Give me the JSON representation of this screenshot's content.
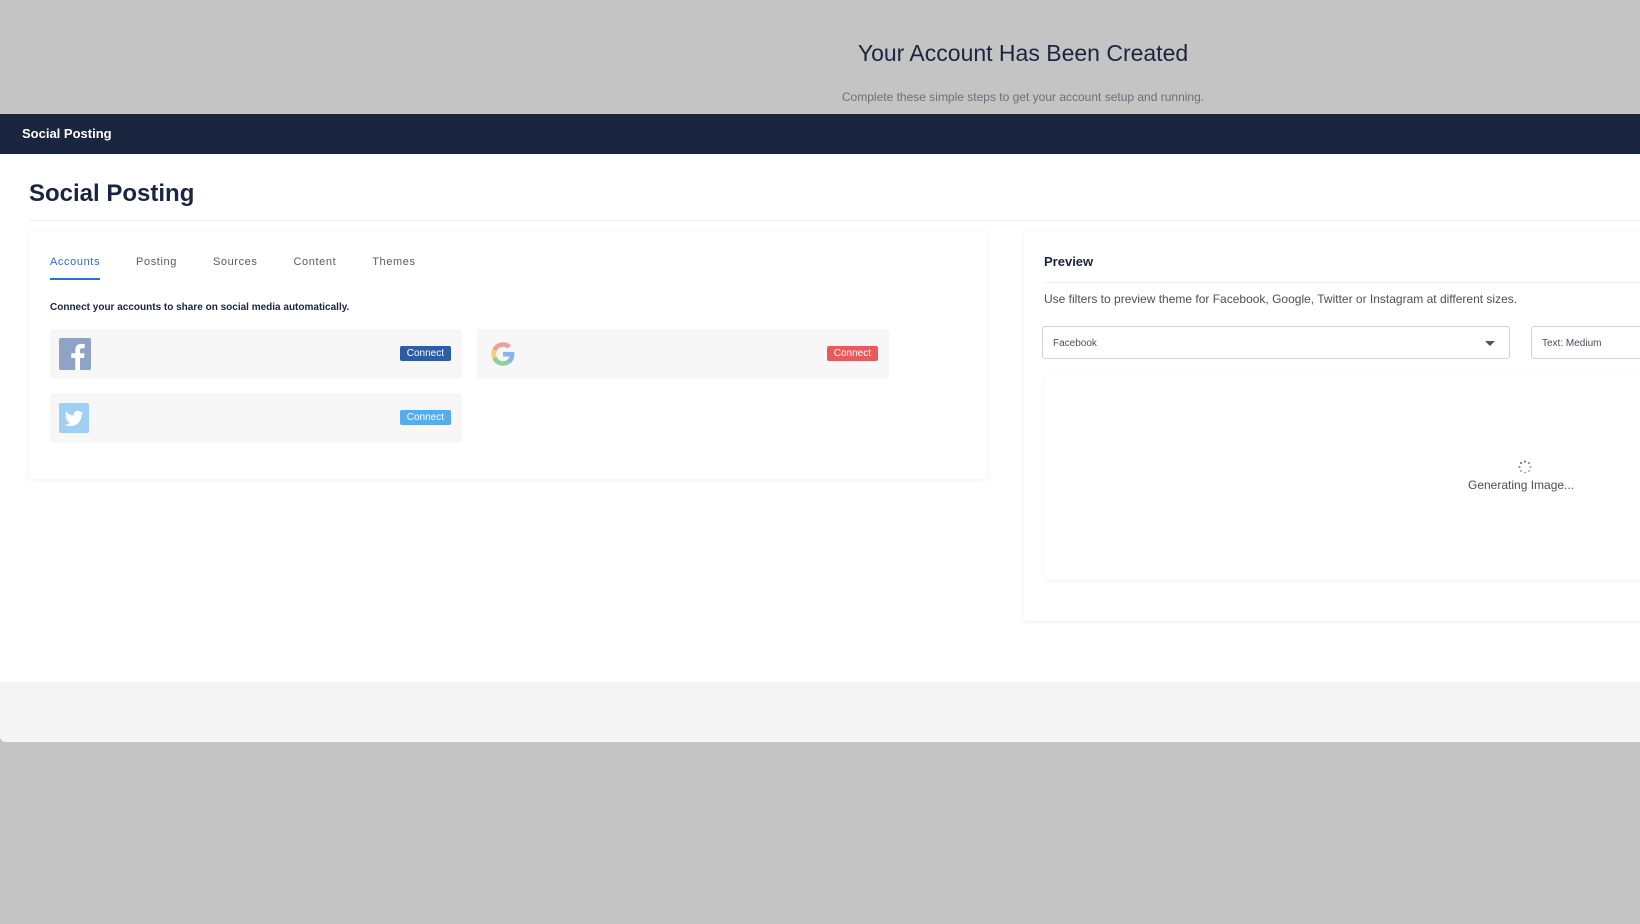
{
  "header": {
    "title": "Your Account Has Been Created",
    "subtitle": "Complete these simple steps to get your account setup and running."
  },
  "topbar": {
    "title": "Social Posting"
  },
  "page": {
    "title": "Social Posting"
  },
  "tabs": [
    {
      "label": "Accounts",
      "active": true
    },
    {
      "label": "Posting",
      "active": false
    },
    {
      "label": "Sources",
      "active": false
    },
    {
      "label": "Content",
      "active": false
    },
    {
      "label": "Themes",
      "active": false
    }
  ],
  "accounts": {
    "instruction": "Connect your accounts to share on social media automatically.",
    "items": [
      {
        "name": "facebook",
        "icon": "facebook-icon",
        "button_label": "Connect",
        "button_color": "#2b5ea7"
      },
      {
        "name": "google",
        "icon": "google-icon",
        "button_label": "Connect",
        "button_color": "#e95b5b"
      },
      {
        "name": "twitter",
        "icon": "twitter-icon",
        "button_label": "Connect",
        "button_color": "#55acee"
      }
    ]
  },
  "preview": {
    "title": "Preview",
    "description": "Use filters to preview theme for Facebook, Google, Twitter or Instagram at different sizes.",
    "platform_select": "Facebook",
    "text_select": "Text: Medium",
    "status": "Generating Image..."
  },
  "colors": {
    "navy": "#1a2540",
    "accent_blue": "#2a6fd6",
    "backdrop": "#c4c4c4"
  }
}
